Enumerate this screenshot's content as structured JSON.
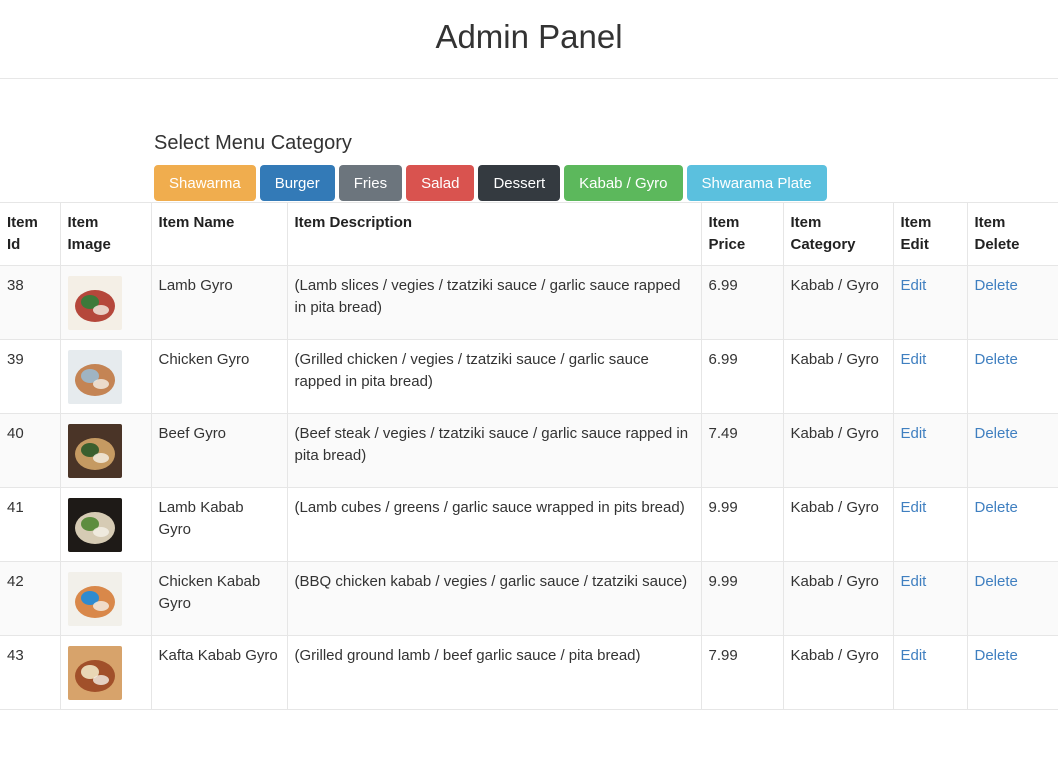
{
  "header": {
    "title": "Admin Panel"
  },
  "categories": {
    "title": "Select Menu Category",
    "buttons": [
      {
        "label": "Shawarma",
        "color": "#f0ad4e"
      },
      {
        "label": "Burger",
        "color": "#337ab7"
      },
      {
        "label": "Fries",
        "color": "#6c757d"
      },
      {
        "label": "Salad",
        "color": "#d9534f"
      },
      {
        "label": "Dessert",
        "color": "#343a40"
      },
      {
        "label": "Kabab / Gyro",
        "color": "#5cb85c"
      },
      {
        "label": "Shwarama Plate",
        "color": "#5bc0de"
      }
    ]
  },
  "table": {
    "headers": {
      "id": "Item Id",
      "image": "Item Image",
      "name": "Item Name",
      "desc": "Item Description",
      "price": "Item Price",
      "category": "Item Category",
      "edit": "Item Edit",
      "delete": "Item Delete"
    },
    "rows": [
      {
        "id": "38",
        "name": "Lamb Gyro",
        "desc": "(Lamb slices / vegies / tzatziki sauce / garlic sauce rapped in pita bread)",
        "price": "6.99",
        "category": "Kabab / Gyro",
        "edit": "Edit",
        "delete": "Delete",
        "thumb": [
          "#f4efe6",
          "#b5473b",
          "#3d7a3a"
        ]
      },
      {
        "id": "39",
        "name": "Chicken Gyro",
        "desc": "(Grilled chicken / vegies / tzatziki sauce / garlic sauce rapped in pita bread)",
        "price": "6.99",
        "category": "Kabab / Gyro",
        "edit": "Edit",
        "delete": "Delete",
        "thumb": [
          "#e6ebee",
          "#c48454",
          "#9fb4c3"
        ]
      },
      {
        "id": "40",
        "name": "Beef Gyro",
        "desc": "(Beef steak / vegies / tzatziki sauce / garlic sauce rapped in pita bread)",
        "price": "7.49",
        "category": "Kabab / Gyro",
        "edit": "Edit",
        "delete": "Delete",
        "thumb": [
          "#4a3427",
          "#c59a62",
          "#3a5f2e"
        ]
      },
      {
        "id": "41",
        "name": "Lamb Kabab Gyro",
        "desc": "(Lamb cubes / greens / garlic sauce wrapped in pits bread)",
        "price": "9.99",
        "category": "Kabab / Gyro",
        "edit": "Edit",
        "delete": "Delete",
        "thumb": [
          "#1e1a17",
          "#d6cbb4",
          "#5d8d3f"
        ]
      },
      {
        "id": "42",
        "name": "Chicken Kabab Gyro",
        "desc": "(BBQ chicken kabab / vegies / garlic sauce / tzatziki sauce)",
        "price": "9.99",
        "category": "Kabab / Gyro",
        "edit": "Edit",
        "delete": "Delete",
        "thumb": [
          "#f2f0ea",
          "#d9884a",
          "#2f8bd0"
        ]
      },
      {
        "id": "43",
        "name": "Kafta Kabab Gyro",
        "desc": "(Grilled ground lamb / beef garlic sauce / pita bread)",
        "price": "7.99",
        "category": "Kabab / Gyro",
        "edit": "Edit",
        "delete": "Delete",
        "thumb": [
          "#d7a36b",
          "#a1502a",
          "#e9d7b5"
        ]
      }
    ]
  }
}
